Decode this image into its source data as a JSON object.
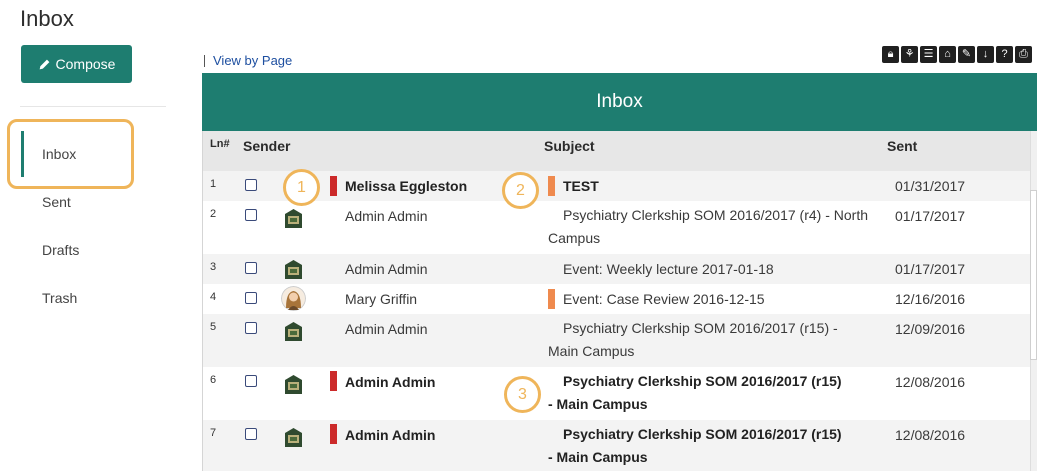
{
  "page": {
    "title": "Inbox"
  },
  "sidebar": {
    "compose_label": "Compose",
    "items": [
      {
        "label": "Inbox",
        "active": true
      },
      {
        "label": "Sent"
      },
      {
        "label": "Drafts"
      },
      {
        "label": "Trash"
      }
    ]
  },
  "toolbar": {
    "view_by_page": "View by Page",
    "icons": [
      "lock-icon",
      "bug-icon",
      "list-icon",
      "archive-icon",
      "edit-icon",
      "download-icon",
      "help-icon",
      "print-icon"
    ]
  },
  "panel": {
    "title": "Inbox"
  },
  "table": {
    "columns": {
      "ln": "Ln#",
      "sender": "Sender",
      "subject": "Subject",
      "sent": "Sent"
    },
    "rows": [
      {
        "ln": "1",
        "sender": "Melissa Eggleston",
        "subject": "TEST",
        "sent": "01/31/2017",
        "unread": true,
        "flag": "red",
        "subject_flag": "orange",
        "avatar": "none"
      },
      {
        "ln": "2",
        "sender": "Admin Admin",
        "subject": "Psychiatry Clerkship SOM 2016/2017 (r4) - North Campus",
        "sent": "01/17/2017",
        "unread": false,
        "avatar": "crest"
      },
      {
        "ln": "3",
        "sender": "Admin Admin",
        "subject": "Event: Weekly lecture 2017-01-18",
        "sent": "01/17/2017",
        "unread": false,
        "avatar": "crest"
      },
      {
        "ln": "4",
        "sender": "Mary Griffin",
        "subject": "Event: Case Review 2016-12-15",
        "sent": "12/16/2016",
        "unread": false,
        "subject_flag": "orange",
        "avatar": "person"
      },
      {
        "ln": "5",
        "sender": "Admin Admin",
        "subject": "Psychiatry Clerkship SOM 2016/2017 (r15) - Main Campus",
        "sent": "12/09/2016",
        "unread": false,
        "avatar": "crest"
      },
      {
        "ln": "6",
        "sender": "Admin Admin",
        "subject": "Psychiatry Clerkship SOM 2016/2017 (r15) - Main Campus",
        "sent": "12/08/2016",
        "unread": true,
        "flag": "red",
        "avatar": "crest"
      },
      {
        "ln": "7",
        "sender": "Admin Admin",
        "subject": "Psychiatry Clerkship SOM 2016/2017 (r15) - Main Campus",
        "sent": "12/08/2016",
        "unread": true,
        "flag": "red",
        "avatar": "crest"
      }
    ]
  },
  "callouts": [
    "1",
    "2",
    "3"
  ],
  "colors": {
    "brand": "#1e7d70",
    "highlight": "#efb55a",
    "flag_red": "#cc2a2a",
    "flag_orange": "#ef8a4e",
    "link": "#1e4fa0"
  }
}
